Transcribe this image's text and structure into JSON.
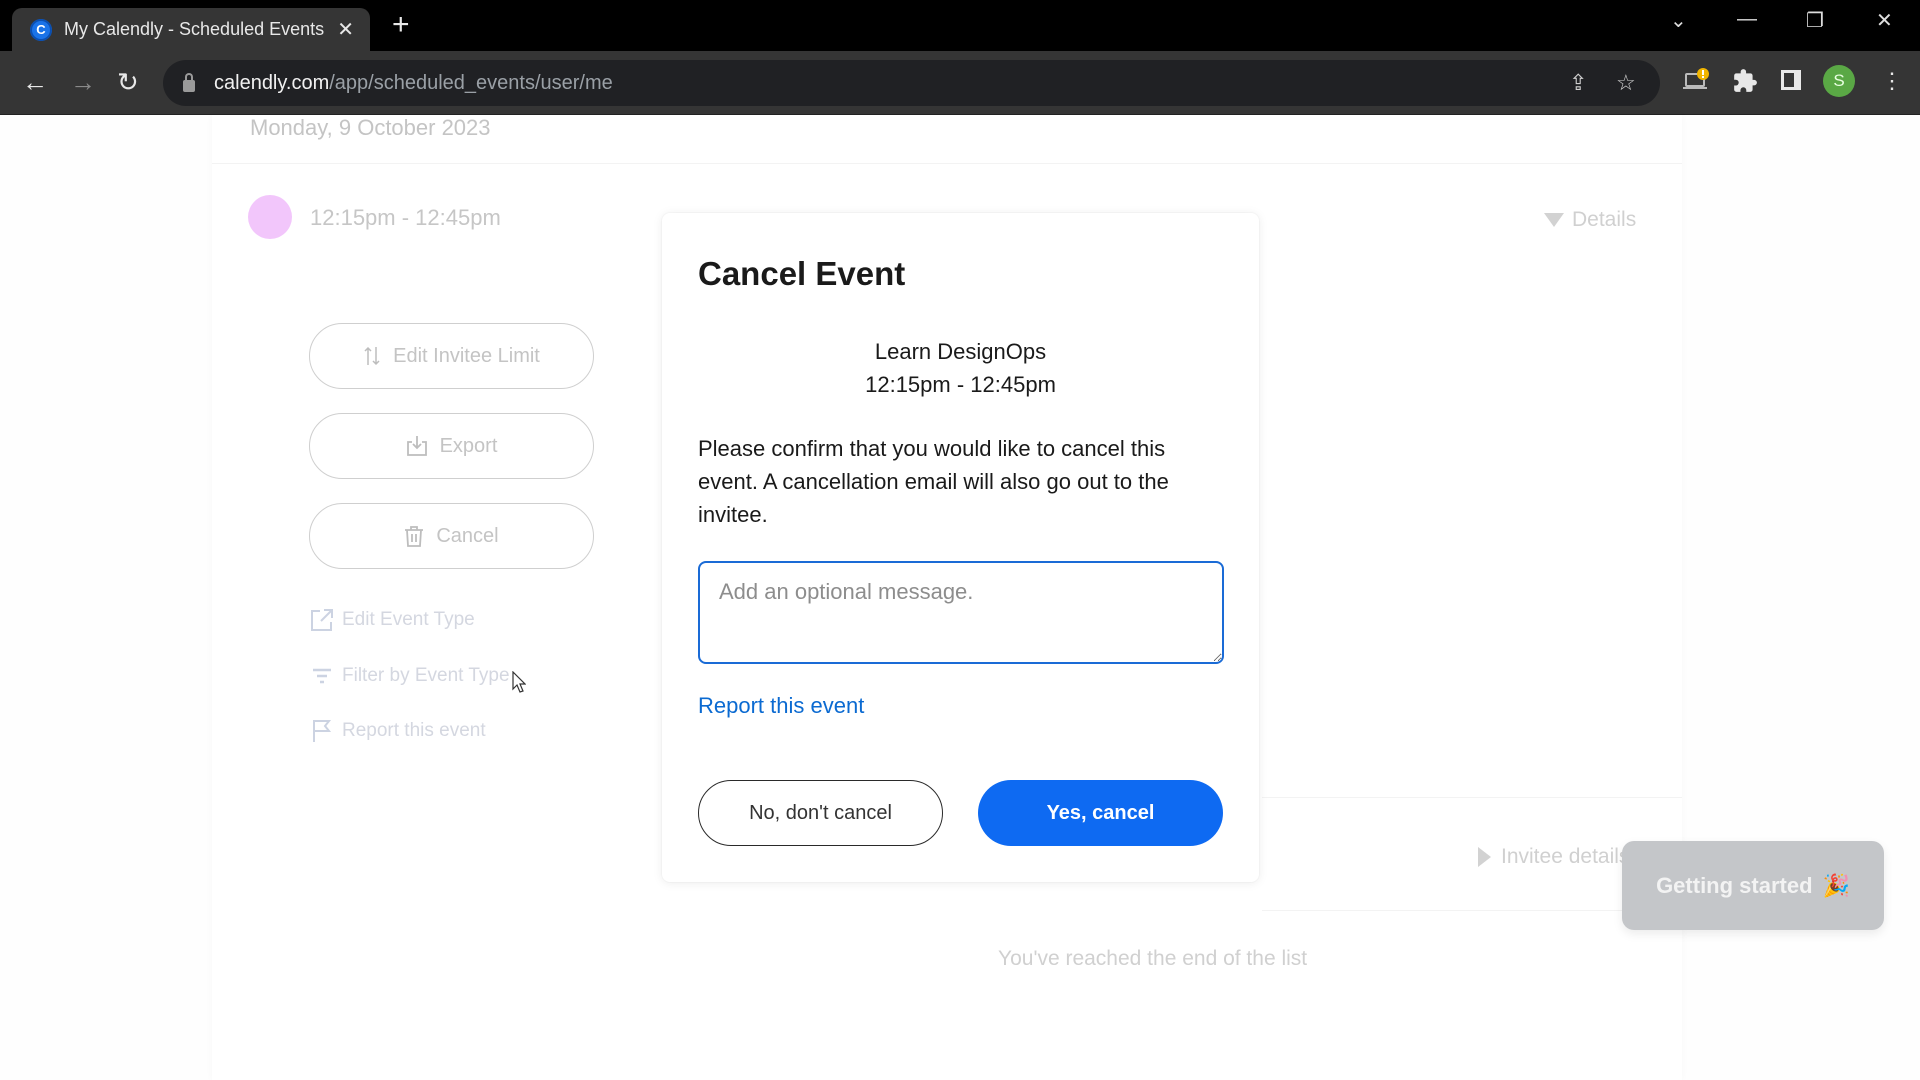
{
  "browser": {
    "tab_title": "My Calendly - Scheduled Events",
    "favicon_letter": "C",
    "url_host": "calendly.com",
    "url_path": "/app/scheduled_events/user/me",
    "profile_initial": "S",
    "icons": {
      "back": "←",
      "forward": "→",
      "reload": "↻",
      "new_tab": "+",
      "close_tab": "✕",
      "tab_search": "⌄",
      "minimize": "—",
      "restore": "❐",
      "close_window": "✕",
      "share": "⇪",
      "bookmark": "☆",
      "extensions": "✚",
      "sidebar": "▮",
      "menu": "⋮"
    }
  },
  "page": {
    "date_header": "Monday, 9 October 2023",
    "event_time": "12:15pm - 12:45pm",
    "event_color": "#f2c6fb",
    "details_label": "Details",
    "actions": {
      "edit_invitee_limit": "Edit Invitee Limit",
      "export": "Export",
      "cancel": "Cancel"
    },
    "links": {
      "edit_event_type": "Edit Event Type",
      "filter_by_event_type": "Filter by Event Type",
      "report_event": "Report this event"
    },
    "invitee_details_label": "Invitee details",
    "end_of_list": "You've reached the end of the list",
    "getting_started": "Getting started",
    "getting_started_emoji": "🎉"
  },
  "modal": {
    "title": "Cancel Event",
    "event_name": "Learn DesignOps",
    "event_time": "12:15pm - 12:45pm",
    "description": "Please confirm that you would like to cancel this event. A cancellation email will also go out to the invitee.",
    "message_value": "",
    "message_placeholder": "Add an optional message.",
    "report_link": "Report this event",
    "no_button": "No, don't cancel",
    "yes_button": "Yes, cancel",
    "accent_color": "#0e6af2"
  }
}
